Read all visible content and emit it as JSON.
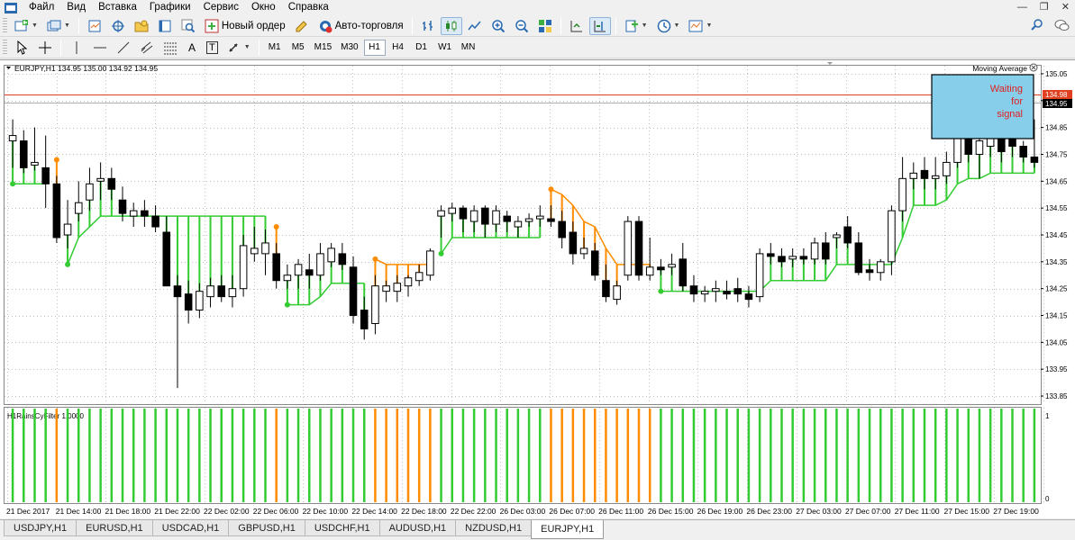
{
  "menu": {
    "items": [
      "Файл",
      "Вид",
      "Вставка",
      "Графики",
      "Сервис",
      "Окно",
      "Справка"
    ]
  },
  "toolbar": {
    "new_order_label": "Новый ордер",
    "autotrading_label": "Авто-торговля",
    "timeframes": [
      "M1",
      "M5",
      "M15",
      "M30",
      "H1",
      "H4",
      "D1",
      "W1",
      "MN"
    ],
    "active_timeframe": "H1",
    "draw_text_label": "A",
    "draw_label_label": "T"
  },
  "chart": {
    "symbol_info": "EURJPY,H1  134.95 135.00 134.92 134.95",
    "indicator_title": "Moving Average",
    "info_box_text": [
      "Waiting",
      "for",
      "signal"
    ],
    "info_box_color": "#87ceeb",
    "price_labels": [
      "135.05",
      "134.95",
      "134.85",
      "134.75",
      "134.65",
      "134.55",
      "134.45",
      "134.35",
      "134.25",
      "134.15",
      "134.05",
      "133.95",
      "133.85"
    ],
    "highlight_price_red": "134.98",
    "highlight_price_black": "134.95",
    "subwindow_title": "H1RainsCyFilter 1.0000",
    "subwindow_scale": [
      "1",
      "0"
    ],
    "time_labels": [
      "21 Dec 2017",
      "21 Dec 14:00",
      "21 Dec 18:00",
      "21 Dec 22:00",
      "22 Dec 02:00",
      "22 Dec 06:00",
      "22 Dec 10:00",
      "22 Dec 14:00",
      "22 Dec 18:00",
      "22 Dec 22:00",
      "26 Dec 03:00",
      "26 Dec 07:00",
      "26 Dec 11:00",
      "26 Dec 15:00",
      "26 Dec 19:00",
      "26 Dec 23:00",
      "27 Dec 03:00",
      "27 Dec 07:00",
      "27 Dec 11:00",
      "27 Dec 15:00",
      "27 Dec 19:00"
    ],
    "colors": {
      "bull_signal": "#33cc33",
      "bear_signal": "#ff8c00",
      "grid": "#c0c0c0",
      "price_line_red": "#e04020"
    }
  },
  "chart_data": {
    "type": "candlestick",
    "symbol": "EURJPY",
    "timeframe": "H1",
    "ylim": [
      133.82,
      135.08
    ],
    "candles": [
      {
        "o": 134.8,
        "h": 134.88,
        "l": 134.7,
        "c": 134.82
      },
      {
        "o": 134.8,
        "h": 134.84,
        "l": 134.68,
        "c": 134.7
      },
      {
        "o": 134.71,
        "h": 134.85,
        "l": 134.69,
        "c": 134.72
      },
      {
        "o": 134.7,
        "h": 134.82,
        "l": 134.55,
        "c": 134.64
      },
      {
        "o": 134.64,
        "h": 134.67,
        "l": 134.42,
        "c": 134.44
      },
      {
        "o": 134.45,
        "h": 134.58,
        "l": 134.4,
        "c": 134.49
      },
      {
        "o": 134.53,
        "h": 134.65,
        "l": 134.5,
        "c": 134.57
      },
      {
        "o": 134.58,
        "h": 134.7,
        "l": 134.54,
        "c": 134.64
      },
      {
        "o": 134.65,
        "h": 134.72,
        "l": 134.58,
        "c": 134.66
      },
      {
        "o": 134.66,
        "h": 134.7,
        "l": 134.58,
        "c": 134.62
      },
      {
        "o": 134.58,
        "h": 134.63,
        "l": 134.5,
        "c": 134.53
      },
      {
        "o": 134.52,
        "h": 134.57,
        "l": 134.48,
        "c": 134.54
      },
      {
        "o": 134.54,
        "h": 134.58,
        "l": 134.48,
        "c": 134.52
      },
      {
        "o": 134.52,
        "h": 134.56,
        "l": 134.46,
        "c": 134.48
      },
      {
        "o": 134.46,
        "h": 134.52,
        "l": 134.28,
        "c": 134.26
      },
      {
        "o": 134.26,
        "h": 134.3,
        "l": 133.88,
        "c": 134.22
      },
      {
        "o": 134.23,
        "h": 134.28,
        "l": 134.12,
        "c": 134.17
      },
      {
        "o": 134.17,
        "h": 134.27,
        "l": 134.14,
        "c": 134.24
      },
      {
        "o": 134.22,
        "h": 134.29,
        "l": 134.18,
        "c": 134.26
      },
      {
        "o": 134.26,
        "h": 134.3,
        "l": 134.2,
        "c": 134.22
      },
      {
        "o": 134.22,
        "h": 134.3,
        "l": 134.18,
        "c": 134.25
      },
      {
        "o": 134.25,
        "h": 134.45,
        "l": 134.22,
        "c": 134.41
      },
      {
        "o": 134.38,
        "h": 134.48,
        "l": 134.35,
        "c": 134.4
      },
      {
        "o": 134.38,
        "h": 134.47,
        "l": 134.3,
        "c": 134.42
      },
      {
        "o": 134.38,
        "h": 134.42,
        "l": 134.25,
        "c": 134.28
      },
      {
        "o": 134.28,
        "h": 134.34,
        "l": 134.25,
        "c": 134.3
      },
      {
        "o": 134.3,
        "h": 134.36,
        "l": 134.25,
        "c": 134.34
      },
      {
        "o": 134.32,
        "h": 134.38,
        "l": 134.25,
        "c": 134.3
      },
      {
        "o": 134.3,
        "h": 134.42,
        "l": 134.28,
        "c": 134.38
      },
      {
        "o": 134.35,
        "h": 134.42,
        "l": 134.33,
        "c": 134.4
      },
      {
        "o": 134.38,
        "h": 134.42,
        "l": 134.32,
        "c": 134.34
      },
      {
        "o": 134.33,
        "h": 134.37,
        "l": 134.12,
        "c": 134.15
      },
      {
        "o": 134.17,
        "h": 134.22,
        "l": 134.06,
        "c": 134.1
      },
      {
        "o": 134.12,
        "h": 134.3,
        "l": 134.08,
        "c": 134.26
      },
      {
        "o": 134.24,
        "h": 134.28,
        "l": 134.2,
        "c": 134.26
      },
      {
        "o": 134.24,
        "h": 134.3,
        "l": 134.2,
        "c": 134.27
      },
      {
        "o": 134.26,
        "h": 134.3,
        "l": 134.22,
        "c": 134.29
      },
      {
        "o": 134.28,
        "h": 134.34,
        "l": 134.26,
        "c": 134.31
      },
      {
        "o": 134.3,
        "h": 134.4,
        "l": 134.28,
        "c": 134.39
      },
      {
        "o": 134.52,
        "h": 134.56,
        "l": 134.44,
        "c": 134.54
      },
      {
        "o": 134.53,
        "h": 134.57,
        "l": 134.5,
        "c": 134.55
      },
      {
        "o": 134.55,
        "h": 134.56,
        "l": 134.46,
        "c": 134.51
      },
      {
        "o": 134.5,
        "h": 134.56,
        "l": 134.46,
        "c": 134.54
      },
      {
        "o": 134.55,
        "h": 134.56,
        "l": 134.44,
        "c": 134.49
      },
      {
        "o": 134.49,
        "h": 134.56,
        "l": 134.46,
        "c": 134.54
      },
      {
        "o": 134.52,
        "h": 134.54,
        "l": 134.46,
        "c": 134.5
      },
      {
        "o": 134.48,
        "h": 134.52,
        "l": 134.44,
        "c": 134.5
      },
      {
        "o": 134.5,
        "h": 134.53,
        "l": 134.48,
        "c": 134.51
      },
      {
        "o": 134.51,
        "h": 134.56,
        "l": 134.48,
        "c": 134.52
      },
      {
        "o": 134.51,
        "h": 134.56,
        "l": 134.48,
        "c": 134.5
      },
      {
        "o": 134.5,
        "h": 134.54,
        "l": 134.4,
        "c": 134.44
      },
      {
        "o": 134.46,
        "h": 134.5,
        "l": 134.34,
        "c": 134.38
      },
      {
        "o": 134.38,
        "h": 134.44,
        "l": 134.36,
        "c": 134.4
      },
      {
        "o": 134.39,
        "h": 134.42,
        "l": 134.28,
        "c": 134.3
      },
      {
        "o": 134.28,
        "h": 134.34,
        "l": 134.2,
        "c": 134.22
      },
      {
        "o": 134.21,
        "h": 134.28,
        "l": 134.19,
        "c": 134.26
      },
      {
        "o": 134.3,
        "h": 134.52,
        "l": 134.28,
        "c": 134.5
      },
      {
        "o": 134.5,
        "h": 134.52,
        "l": 134.28,
        "c": 134.3
      },
      {
        "o": 134.3,
        "h": 134.44,
        "l": 134.28,
        "c": 134.33
      },
      {
        "o": 134.33,
        "h": 134.36,
        "l": 134.3,
        "c": 134.32
      },
      {
        "o": 134.33,
        "h": 134.38,
        "l": 134.3,
        "c": 134.34
      },
      {
        "o": 134.36,
        "h": 134.42,
        "l": 134.24,
        "c": 134.26
      },
      {
        "o": 134.26,
        "h": 134.3,
        "l": 134.2,
        "c": 134.23
      },
      {
        "o": 134.23,
        "h": 134.26,
        "l": 134.2,
        "c": 134.24
      },
      {
        "o": 134.24,
        "h": 134.28,
        "l": 134.2,
        "c": 134.25
      },
      {
        "o": 134.24,
        "h": 134.28,
        "l": 134.21,
        "c": 134.23
      },
      {
        "o": 134.25,
        "h": 134.29,
        "l": 134.2,
        "c": 134.23
      },
      {
        "o": 134.23,
        "h": 134.26,
        "l": 134.18,
        "c": 134.21
      },
      {
        "o": 134.22,
        "h": 134.4,
        "l": 134.2,
        "c": 134.38
      },
      {
        "o": 134.38,
        "h": 134.42,
        "l": 134.34,
        "c": 134.37
      },
      {
        "o": 134.37,
        "h": 134.4,
        "l": 134.33,
        "c": 134.35
      },
      {
        "o": 134.36,
        "h": 134.4,
        "l": 134.33,
        "c": 134.37
      },
      {
        "o": 134.37,
        "h": 134.4,
        "l": 134.34,
        "c": 134.36
      },
      {
        "o": 134.36,
        "h": 134.44,
        "l": 134.34,
        "c": 134.42
      },
      {
        "o": 134.42,
        "h": 134.46,
        "l": 134.34,
        "c": 134.36
      },
      {
        "o": 134.44,
        "h": 134.46,
        "l": 134.4,
        "c": 134.45
      },
      {
        "o": 134.48,
        "h": 134.52,
        "l": 134.4,
        "c": 134.42
      },
      {
        "o": 134.42,
        "h": 134.46,
        "l": 134.3,
        "c": 134.31
      },
      {
        "o": 134.32,
        "h": 134.36,
        "l": 134.28,
        "c": 134.31
      },
      {
        "o": 134.31,
        "h": 134.36,
        "l": 134.28,
        "c": 134.35
      },
      {
        "o": 134.35,
        "h": 134.56,
        "l": 134.3,
        "c": 134.54
      },
      {
        "o": 134.54,
        "h": 134.74,
        "l": 134.5,
        "c": 134.66
      },
      {
        "o": 134.66,
        "h": 134.72,
        "l": 134.62,
        "c": 134.68
      },
      {
        "o": 134.69,
        "h": 134.74,
        "l": 134.62,
        "c": 134.66
      },
      {
        "o": 134.66,
        "h": 134.74,
        "l": 134.62,
        "c": 134.67
      },
      {
        "o": 134.67,
        "h": 134.76,
        "l": 134.64,
        "c": 134.72
      },
      {
        "o": 134.72,
        "h": 134.9,
        "l": 134.7,
        "c": 134.9
      },
      {
        "o": 134.9,
        "h": 134.98,
        "l": 134.72,
        "c": 134.75
      },
      {
        "o": 134.75,
        "h": 134.84,
        "l": 134.66,
        "c": 134.8
      },
      {
        "o": 134.78,
        "h": 134.86,
        "l": 134.74,
        "c": 134.82
      },
      {
        "o": 134.82,
        "h": 134.86,
        "l": 134.72,
        "c": 134.76
      },
      {
        "o": 134.82,
        "h": 134.86,
        "l": 134.74,
        "c": 134.78
      },
      {
        "o": 134.78,
        "h": 134.8,
        "l": 134.72,
        "c": 134.74
      },
      {
        "o": 134.74,
        "h": 134.88,
        "l": 134.7,
        "c": 134.72
      }
    ],
    "signal_filter": [
      1,
      1,
      1,
      1,
      0,
      1,
      1,
      1,
      1,
      1,
      1,
      1,
      1,
      1,
      1,
      1,
      1,
      1,
      1,
      1,
      1,
      1,
      1,
      1,
      0,
      1,
      1,
      1,
      1,
      1,
      1,
      1,
      1,
      0,
      0,
      0,
      0,
      0,
      0,
      1,
      1,
      1,
      1,
      1,
      1,
      1,
      1,
      1,
      1,
      0,
      0,
      0,
      0,
      0,
      0,
      0,
      0,
      0,
      0,
      1,
      1,
      1,
      1,
      1,
      1,
      1,
      1,
      1,
      1,
      1,
      1,
      1,
      1,
      1,
      1,
      1,
      1,
      1,
      1,
      1,
      1,
      1,
      1,
      1,
      1,
      1,
      1,
      1,
      1,
      1,
      1,
      1,
      1,
      1
    ]
  }
}
